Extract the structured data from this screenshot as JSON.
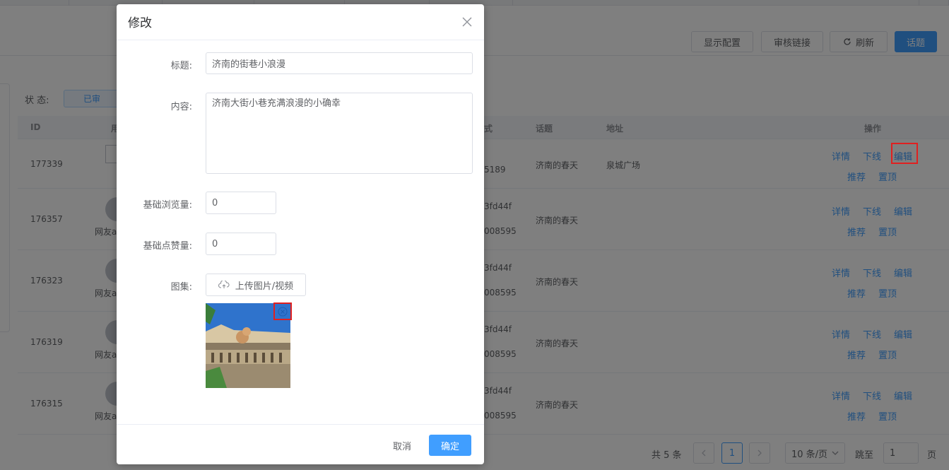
{
  "toolbar": {
    "display_config": "显示配置",
    "review_link": "审核链接",
    "refresh": "刷新",
    "topic": "话题"
  },
  "filter": {
    "status_label": "状 态:",
    "status_value": "已审"
  },
  "table": {
    "headers": {
      "id": "ID",
      "user": "用",
      "method": "式",
      "topic": "话题",
      "address": "地址",
      "actions": "操作"
    },
    "rows": [
      {
        "id": "177339",
        "user": "",
        "method_a": "",
        "method_b": "5189",
        "topic": "济南的春天",
        "address": "泉城广场"
      },
      {
        "id": "176357",
        "user": "网友a",
        "method_a": "3fd44f",
        "method_b": "008595",
        "topic": "济南的春天",
        "address": ""
      },
      {
        "id": "176323",
        "user": "网友a",
        "method_a": "3fd44f",
        "method_b": "008595",
        "topic": "济南的春天",
        "address": ""
      },
      {
        "id": "176319",
        "user": "网友a",
        "method_a": "3fd44f",
        "method_b": "008595",
        "topic": "济南的春天",
        "address": ""
      },
      {
        "id": "176315",
        "user": "网友a",
        "method_a": "3fd44f",
        "method_b": "008595",
        "topic": "济南的春天",
        "address": ""
      }
    ],
    "ops": {
      "detail": "详情",
      "offline": "下线",
      "edit": "编辑",
      "recommend": "推荐",
      "pin": "置顶"
    }
  },
  "pager": {
    "total": "共 5 条",
    "current": "1",
    "size": "10 条/页",
    "goto_label": "跳至",
    "goto_value": "1",
    "goto_unit": "页"
  },
  "dialog": {
    "title": "修改",
    "fields": {
      "title_label": "标题:",
      "title_value": "济南的街巷小浪漫",
      "content_label": "内容:",
      "content_value": "济南大街小巷充满浪漫的小确幸",
      "views_label": "基础浏览量:",
      "views_value": "0",
      "likes_label": "基础点赞量:",
      "likes_value": "0",
      "gallery_label": "图集:",
      "upload_label": "上传图片/视频"
    },
    "cancel": "取消",
    "confirm": "确定"
  },
  "icons": {
    "close": "close-icon",
    "refresh": "refresh-icon",
    "upload": "cloud-upload-icon",
    "remove": "circle-close-icon",
    "chevron_left": "chevron-left-icon",
    "chevron_right": "chevron-right-icon",
    "chevron_down": "chevron-down-icon"
  },
  "colors": {
    "primary": "#409eff",
    "highlight": "#e02020",
    "mask": "rgba(0,0,0,0.5)"
  }
}
